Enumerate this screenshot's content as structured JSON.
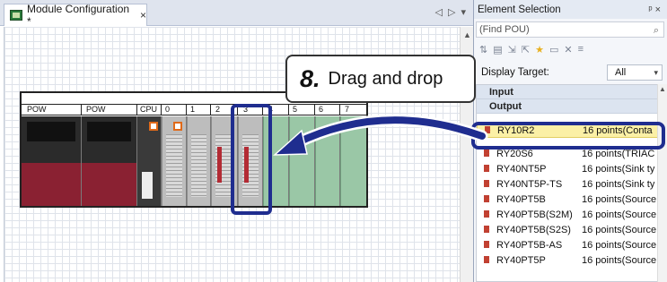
{
  "left_tab": {
    "title": "Module Configuration *",
    "close": "×"
  },
  "left_tab_controls": {
    "prev": "◁",
    "next": "▷",
    "menu": "▾"
  },
  "slots": [
    "POW",
    "POW",
    "CPU",
    "0",
    "1",
    "2",
    "3",
    "4",
    "5",
    "6",
    "7"
  ],
  "callout": {
    "number": "8.",
    "text": "Drag and drop"
  },
  "right_panel": {
    "title": "Element Selection",
    "pin": "ᵖ ×",
    "find_placeholder": "(Find POU)",
    "display_target_label": "Display Target:",
    "display_target_value": "All",
    "sections": [
      "Input",
      "Output"
    ],
    "rows": [
      {
        "name": "RY10R2",
        "desc": "16 points(Conta",
        "selected": true
      },
      {
        "name": "RY20S6",
        "desc": "16 points(TRIAC",
        "selected": false
      },
      {
        "name": "RY40NT5P",
        "desc": "16 points(Sink ty",
        "selected": false
      },
      {
        "name": "RY40NT5P-TS",
        "desc": "16 points(Sink ty",
        "selected": false
      },
      {
        "name": "RY40PT5B",
        "desc": "16 points(Source",
        "selected": false
      },
      {
        "name": "RY40PT5B(S2M)",
        "desc": "16 points(Source",
        "selected": false
      },
      {
        "name": "RY40PT5B(S2S)",
        "desc": "16 points(Source",
        "selected": false
      },
      {
        "name": "RY40PT5B-AS",
        "desc": "16 points(Source",
        "selected": false
      },
      {
        "name": "RY40PT5P",
        "desc": "16 points(Source",
        "selected": false
      }
    ]
  },
  "colors": {
    "highlight": "#1f2d8f",
    "selected_row": "#fbf0a6",
    "module_red": "#8a2132",
    "module_green": "#9ac7a6"
  }
}
